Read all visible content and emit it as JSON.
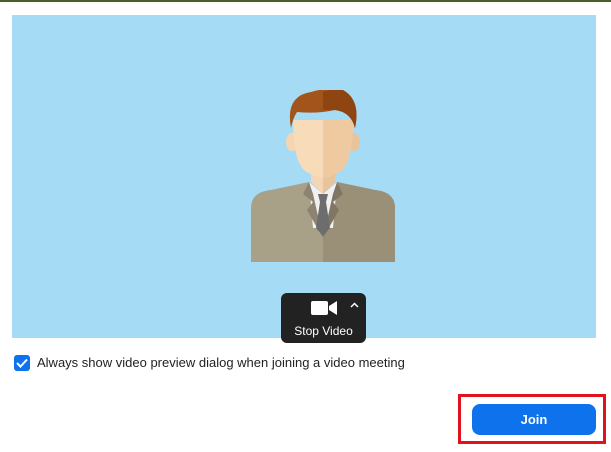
{
  "preview": {
    "avatar_icon": "person-avatar-icon",
    "stop_video_label": "Stop Video",
    "camera_icon": "video-camera-icon",
    "options_icon": "chevron-up-icon",
    "background_color": "#a5dbf4"
  },
  "options": {
    "always_show_preview_label": "Always show video preview dialog when joining a video meeting",
    "always_show_preview_checked": true
  },
  "footer": {
    "join_label": "Join"
  },
  "colors": {
    "accent": "#0e72ed",
    "highlight": "#e1121b",
    "control_bar": "#222222"
  }
}
